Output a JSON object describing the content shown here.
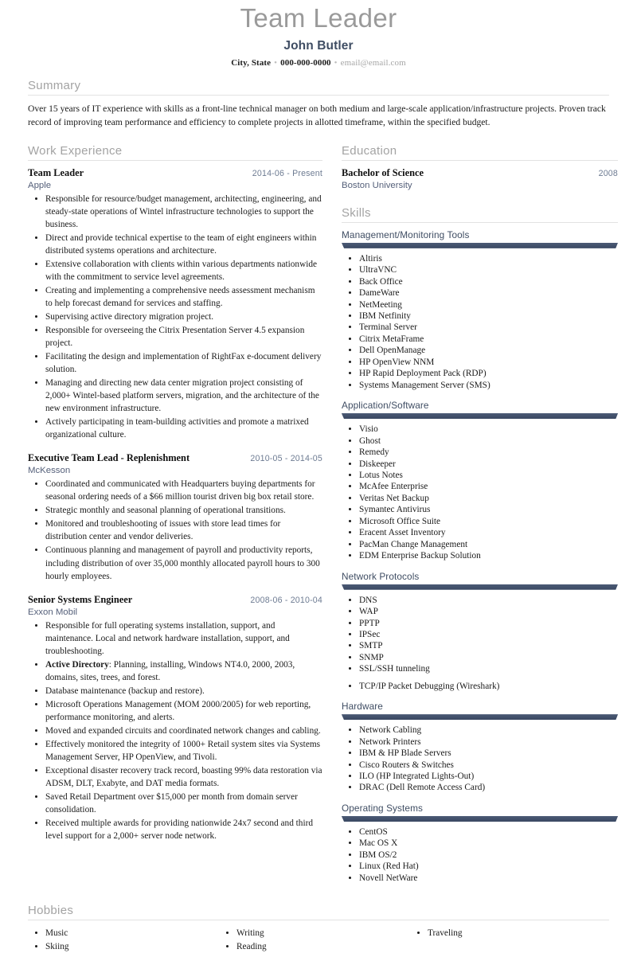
{
  "header": {
    "title": "Team Leader",
    "name": "John Butler",
    "location": "City, State",
    "phone": "000-000-0000",
    "email": "email@email.com",
    "separator": "•"
  },
  "summary": {
    "heading": "Summary",
    "text": "Over 15 years of IT experience with skills as a front-line technical manager on both medium and large-scale application/infrastructure projects. Proven track record of improving team performance and efficiency to complete projects in allotted timeframe, within the specified budget."
  },
  "work": {
    "heading": "Work Experience",
    "jobs": [
      {
        "title": "Team Leader",
        "date": "2014-06 - Present",
        "org": "Apple",
        "bullets": [
          "Responsible for resource/budget management, architecting, engineering, and steady-state operations of Wintel infrastructure technologies to support the business.",
          "Direct and provide technical expertise to the team of eight engineers within distributed systems operations and architecture.",
          "Extensive collaboration with clients within various departments nationwide with the commitment to service level agreements.",
          "Creating and implementing a comprehensive needs assessment mechanism to help forecast demand for services and staffing.",
          "Supervising active directory migration project.",
          "Responsible for overseeing the Citrix Presentation Server 4.5 expansion project.",
          "Facilitating the design and implementation of RightFax e-document delivery solution.",
          "Managing and directing new data center migration project consisting of 2,000+ Wintel-based platform servers, migration, and the architecture of the new environment infrastructure.",
          "Actively participating in team-building activities and promote a matrixed organizational culture."
        ]
      },
      {
        "title": "Executive Team Lead - Replenishment",
        "date": "2010-05 - 2014-05",
        "org": "McKesson",
        "bullets": [
          "Coordinated and communicated with Headquarters buying departments for seasonal ordering needs of a $66 million tourist driven big box retail store.",
          "Strategic monthly and seasonal planning of operational transitions.",
          "Monitored and troubleshooting of issues with store lead times for distribution center and vendor deliveries.",
          "Continuous planning and management of payroll and productivity reports, including distribution of over 35,000 monthly allocated payroll hours to 300 hourly employees."
        ]
      },
      {
        "title": "Senior Systems Engineer",
        "date": "2008-06 - 2010-04",
        "org": "Exxon Mobil",
        "bullets": [
          "Responsible for full operating systems installation, support, and maintenance. Local and network hardware installation, support, and troubleshooting.",
          "Active Directory: Planning, installing, Windows NT4.0, 2000, 2003, domains, sites, trees, and forest.",
          "Database maintenance (backup and restore).",
          "Microsoft Operations Management (MOM 2000/2005) for web reporting, performance monitoring, and alerts.",
          "Moved and expanded circuits and coordinated network changes and cabling.",
          "Effectively monitored the integrity of 1000+ Retail system sites via Systems Management Server, HP OpenView, and Tivoli.",
          "Exceptional disaster recovery track record, boasting 99% data restoration via ADSM, DLT, Exabyte, and DAT media formats.",
          "Saved Retail Department over $15,000 per month from domain server consolidation.",
          "Received multiple awards for providing nationwide 24x7 second and third level support for a 2,000+ server node network."
        ],
        "bold_prefixes": {
          "1": "Active Directory"
        }
      }
    ]
  },
  "education": {
    "heading": "Education",
    "entries": [
      {
        "degree": "Bachelor of Science",
        "year": "2008",
        "school": "Boston University"
      }
    ]
  },
  "skills": {
    "heading": "Skills",
    "groups": [
      {
        "category": "Management/Monitoring Tools",
        "items": [
          "Altiris",
          "UltraVNC",
          "Back Office",
          "DameWare",
          "NetMeeting",
          "IBM Netfinity",
          "Terminal Server",
          "Citrix MetaFrame",
          "Dell OpenManage",
          "HP OpenView NNM",
          "HP Rapid Deployment Pack (RDP)",
          "Systems Management Server (SMS)"
        ]
      },
      {
        "category": "Application/Software",
        "items": [
          "Visio",
          "Ghost",
          "Remedy",
          "Diskeeper",
          "Lotus Notes",
          "McAfee Enterprise",
          "Veritas Net Backup",
          "Symantec Antivirus",
          "Microsoft Office Suite",
          "Eracent Asset Inventory",
          "PacMan Change Management",
          "EDM Enterprise Backup Solution"
        ]
      },
      {
        "category": "Network Protocols",
        "items": [
          "DNS",
          "WAP",
          "PPTP",
          "IPSec",
          "SMTP",
          "SNMP",
          "SSL/SSH tunneling",
          "TCP/IP Packet Debugging (Wireshark)"
        ],
        "spaced_index": 7
      },
      {
        "category": "Hardware",
        "items": [
          "Network Cabling",
          "Network Printers",
          "IBM & HP Blade Servers",
          "Cisco Routers & Switches",
          "ILO (HP Integrated Lights-Out)",
          "DRAC (Dell Remote Access Card)"
        ]
      },
      {
        "category": "Operating Systems",
        "items": [
          "CentOS",
          "Mac OS X",
          "IBM OS/2",
          "Linux (Red Hat)",
          "Novell NetWare"
        ]
      }
    ]
  },
  "hobbies": {
    "heading": "Hobbies",
    "columns": [
      [
        "Music",
        "Skiing"
      ],
      [
        "Writing",
        "Reading"
      ],
      [
        "Traveling"
      ]
    ]
  },
  "colors": {
    "accent_navy": "#41506b",
    "heading_gray": "#a3a3a3",
    "name_navy": "#3f4d63",
    "date_slate": "#6d7b92",
    "divider": "#e2e2e2"
  }
}
